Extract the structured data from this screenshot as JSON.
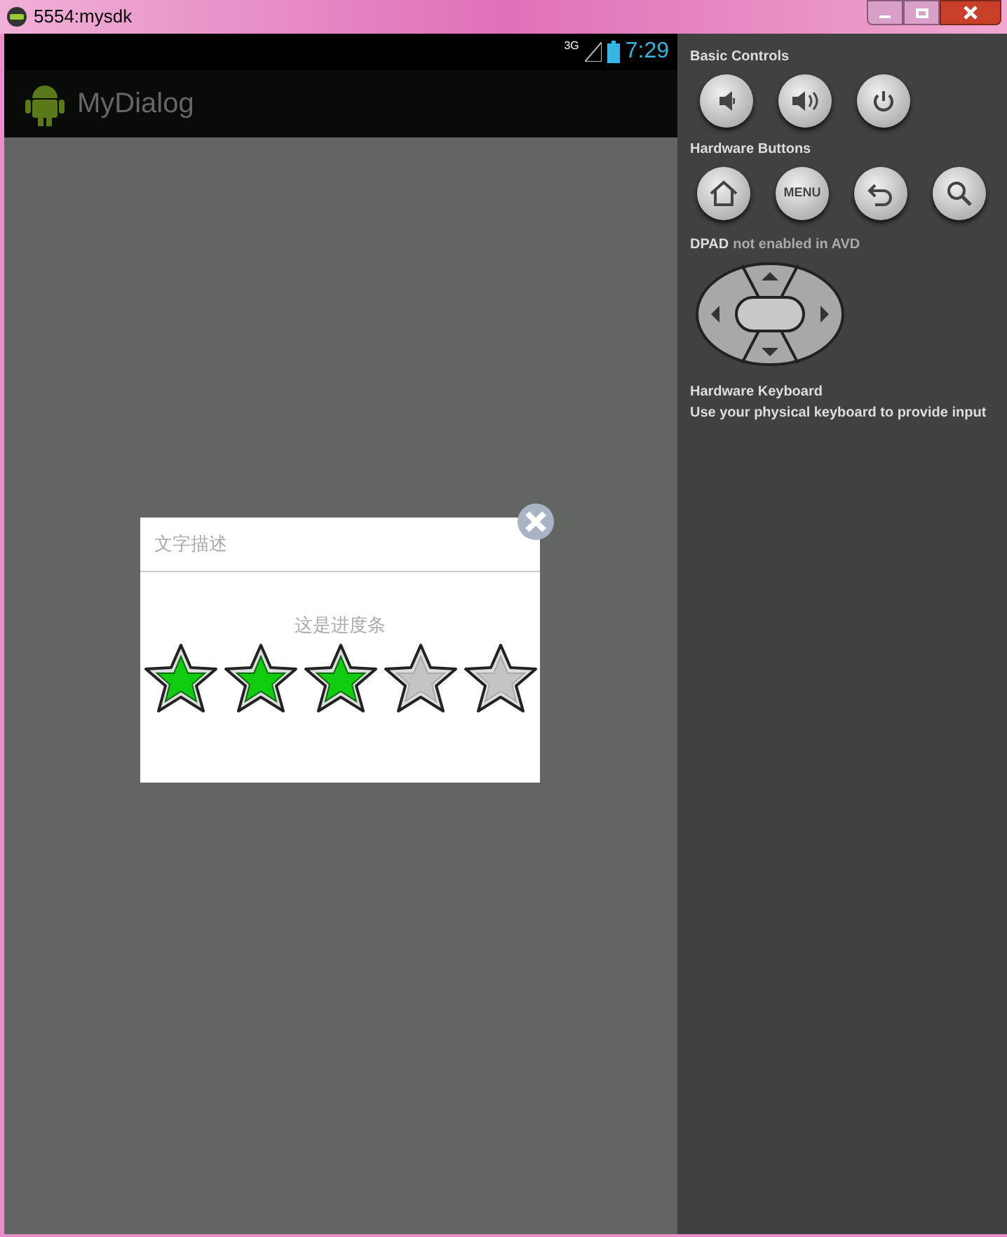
{
  "window": {
    "title": "5554:mysdk"
  },
  "status_bar": {
    "network": "3G",
    "time": "7:29"
  },
  "action_bar": {
    "title": "MyDialog"
  },
  "dialog": {
    "title": "文字描述",
    "message": "这是进度条",
    "rating": {
      "stars": 3
    }
  },
  "controls": {
    "basic_title": "Basic Controls",
    "hardware_title": "Hardware Buttons",
    "menu_label": "MENU",
    "dpad_title": "DPAD",
    "dpad_note": "not enabled in AVD",
    "keyboard_title": "Hardware Keyboard",
    "keyboard_note": "Use your physical keyboard to provide input"
  }
}
